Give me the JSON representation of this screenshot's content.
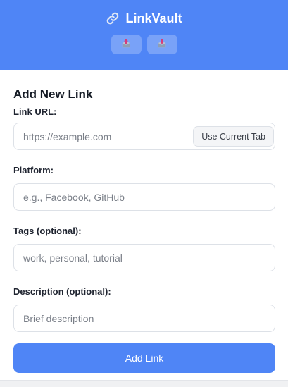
{
  "header": {
    "title": "LinkVault",
    "title_icon": "link-icon",
    "buttons": [
      {
        "icon": "export-icon"
      },
      {
        "icon": "import-icon"
      }
    ],
    "colors": {
      "background": "#4f85f6",
      "text": "#ffffff"
    }
  },
  "form": {
    "title": "Add New Link",
    "url": {
      "label": "Link URL:",
      "placeholder": "https://example.com",
      "value": "",
      "use_current_tab_label": "Use Current Tab"
    },
    "platform": {
      "label": "Platform:",
      "placeholder": "e.g., Facebook, GitHub",
      "value": ""
    },
    "tags": {
      "label": "Tags (optional):",
      "placeholder": "work, personal, tutorial",
      "value": ""
    },
    "description": {
      "label": "Description (optional):",
      "placeholder": "Brief description",
      "value": ""
    },
    "submit_label": "Add Link",
    "accent_color": "#4f85f6"
  }
}
